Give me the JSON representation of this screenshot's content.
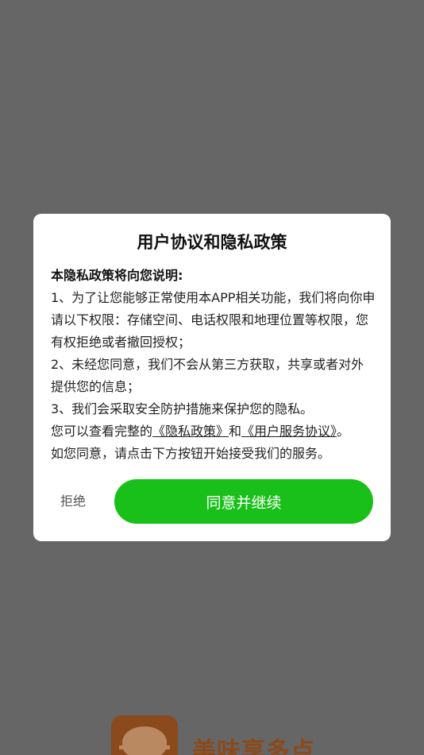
{
  "splash": {
    "app_name": "美味享多点"
  },
  "dialog": {
    "title": "用户协议和隐私政策",
    "intro": "本隐私政策将向您说明:",
    "item1": "1、为了让您能够正常使用本APP相关功能，我们将向你申请以下权限：存储空间、电话权限和地理位置等权限，您有权拒绝或者撤回授权；",
    "item2": "2、未经您同意，我们不会从第三方获取，共享或者对外提供您的信息；",
    "item3": "3、我们会采取安全防护措施来保护您的隐私。",
    "view_prefix": "您可以查看完整的",
    "privacy_link": "《隐私政策》",
    "and": "和",
    "service_link": "《用户服务协议》",
    "period": "。",
    "consent_line": "如您同意，请点击下方按钮开始接受我们的服务。",
    "reject_label": "拒绝",
    "agree_label": "同意并继续"
  },
  "colors": {
    "overlay": "#666666",
    "primary_button": "#1ac01a",
    "brand": "#8a4a1c"
  }
}
